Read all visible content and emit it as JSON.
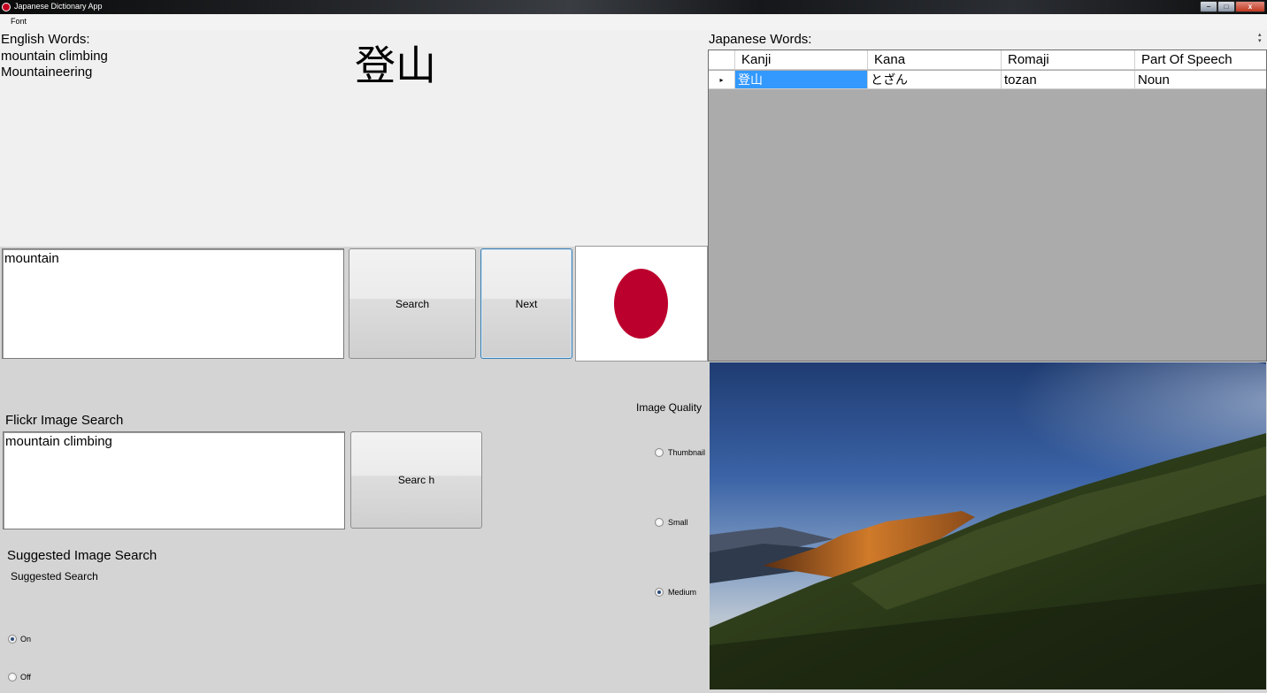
{
  "window": {
    "title": "Japanese Dictionary App",
    "minimize_glyph": "–",
    "maximize_glyph": "□",
    "close_glyph": "x"
  },
  "menu": {
    "items": [
      "Font"
    ]
  },
  "english": {
    "label": "English Words:",
    "words": [
      "mountain climbing",
      "Mountaineering"
    ]
  },
  "kanji_display": "登山",
  "japanese": {
    "label": "Japanese Words:",
    "columns": [
      "Kanji",
      "Kana",
      "Romaji",
      "Part Of Speech"
    ],
    "rows": [
      {
        "kanji": "登山",
        "kana": "とざん",
        "romaji": "tozan",
        "pos": "Noun"
      }
    ],
    "row_marker": "▸",
    "scroll_glyph": "▴\n▾"
  },
  "search": {
    "input_value": "mountain",
    "search_label": "Search",
    "next_label": "Next"
  },
  "flag": {
    "name": "japan-flag",
    "disc_color": "#bc002d"
  },
  "flickr": {
    "label": "Flickr Image Search",
    "input_value": "mountain climbing",
    "button_label": "Searc h"
  },
  "image_quality": {
    "label": "Image Quality",
    "options": [
      "Thumbnail",
      "Small",
      "Medium"
    ],
    "selected": "Medium"
  },
  "suggested": {
    "title": "Suggested Image Search",
    "subtitle": "Suggested Search",
    "options": [
      "On",
      "Off"
    ],
    "selected": "On"
  },
  "colors": {
    "selection": "#3399ff",
    "grid_background": "#ababab",
    "next_focus_border": "#3c7fb1"
  }
}
